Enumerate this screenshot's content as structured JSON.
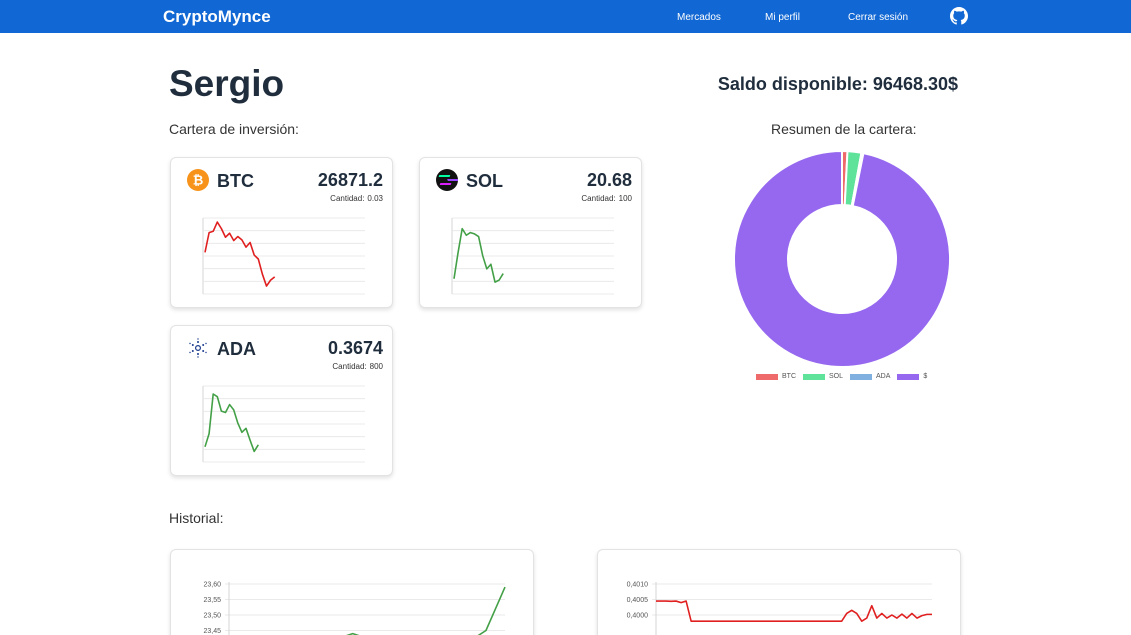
{
  "nav": {
    "brand": "CryptoMynce",
    "links": [
      "Mercados",
      "Mi perfil",
      "Cerrar sesión"
    ],
    "github_icon": "github-icon"
  },
  "user": {
    "name": "Sergio"
  },
  "balance": {
    "label": "Saldo disponible: 96468.30$"
  },
  "portfolio": {
    "title": "Cartera de inversión:",
    "qty_label": "Cantidad:",
    "cards": [
      {
        "symbol": "BTC",
        "price": "26871.2",
        "qty": "0.03",
        "icon": "bitcoin-icon",
        "trend_color": "#e02020",
        "series": [
          6,
          9,
          9.2,
          10.6,
          9.6,
          8.3,
          8.9,
          7.8,
          8.4,
          7.9,
          6.8,
          7.5,
          5.6,
          5,
          2.7,
          0.9,
          1.8,
          2.3
        ]
      },
      {
        "symbol": "SOL",
        "price": "20.68",
        "qty": "100",
        "icon": "solana-icon",
        "trend_color": "#43a047",
        "series": [
          2,
          6,
          9.6,
          8.6,
          9,
          8.8,
          8.4,
          5.5,
          3.5,
          4.2,
          1.5,
          1.8,
          2.8
        ]
      },
      {
        "symbol": "ADA",
        "price": "0.3674",
        "qty": "800",
        "icon": "cardano-icon",
        "trend_color": "#43a047",
        "series": [
          2,
          4,
          10,
          9.6,
          7.4,
          7.2,
          8.4,
          7.6,
          5.6,
          4.2,
          4.8,
          3,
          1.3,
          2.3
        ]
      }
    ]
  },
  "summary": {
    "title": "Resumen de la cartera:",
    "legend": [
      {
        "label": "BTC",
        "color": "#ef6b6b"
      },
      {
        "label": "SOL",
        "color": "#5fe39a"
      },
      {
        "label": "ADA",
        "color": "#7fb0e0"
      },
      {
        "label": "$",
        "color": "#9568ef"
      }
    ]
  },
  "history": {
    "title": "Historial:",
    "charts": [
      {
        "ticks": [
          "23,60",
          "23,55",
          "23,50",
          "23,45"
        ],
        "color": "#43a047"
      },
      {
        "ticks": [
          "0,4010",
          "0,4005",
          "0,4000"
        ],
        "color": "#e02020"
      }
    ]
  },
  "chart_data": [
    {
      "type": "pie",
      "title": "Resumen de la cartera:",
      "categories": [
        "BTC",
        "SOL",
        "ADA",
        "$"
      ],
      "values": [
        806.1,
        2068,
        293.9,
        96468.3
      ]
    },
    {
      "type": "line",
      "ylabel": "",
      "ylim": [
        23.43,
        23.6
      ],
      "y_ticks": [
        23.6,
        23.55,
        23.5,
        23.45
      ],
      "values": [
        23.43,
        23.43,
        23.43,
        23.43,
        23.43,
        23.43,
        23.43,
        23.43,
        23.43,
        23.43,
        23.43,
        23.43,
        23.43,
        23.44,
        23.43,
        23.43,
        23.43,
        23.43,
        23.43,
        23.43,
        23.43,
        23.43,
        23.43,
        23.43,
        23.43,
        23.43,
        23.43,
        23.45,
        23.52,
        23.59
      ]
    },
    {
      "type": "line",
      "ylim": [
        0.39985,
        0.40105
      ],
      "y_ticks": [
        0.401,
        0.4005,
        0.4
      ],
      "values": [
        0.40045,
        0.40045,
        0.40045,
        0.40044,
        0.40045,
        0.4004,
        0.40045,
        0.3998,
        0.3998,
        0.3998,
        0.3998,
        0.3998,
        0.3998,
        0.3998,
        0.3998,
        0.3998,
        0.3998,
        0.3998,
        0.3998,
        0.3998,
        0.3998,
        0.3998,
        0.3998,
        0.3998,
        0.3998,
        0.3998,
        0.3998,
        0.3998,
        0.3998,
        0.3998,
        0.3998,
        0.3998,
        0.3998,
        0.3998,
        0.3998,
        0.3998,
        0.3998,
        0.3998,
        0.40005,
        0.40015,
        0.40005,
        0.3998,
        0.3999,
        0.4003,
        0.3999,
        0.40005,
        0.3999,
        0.4,
        0.3999,
        0.40003,
        0.3999,
        0.40005,
        0.3999,
        0.39998,
        0.40002,
        0.40002
      ]
    }
  ]
}
